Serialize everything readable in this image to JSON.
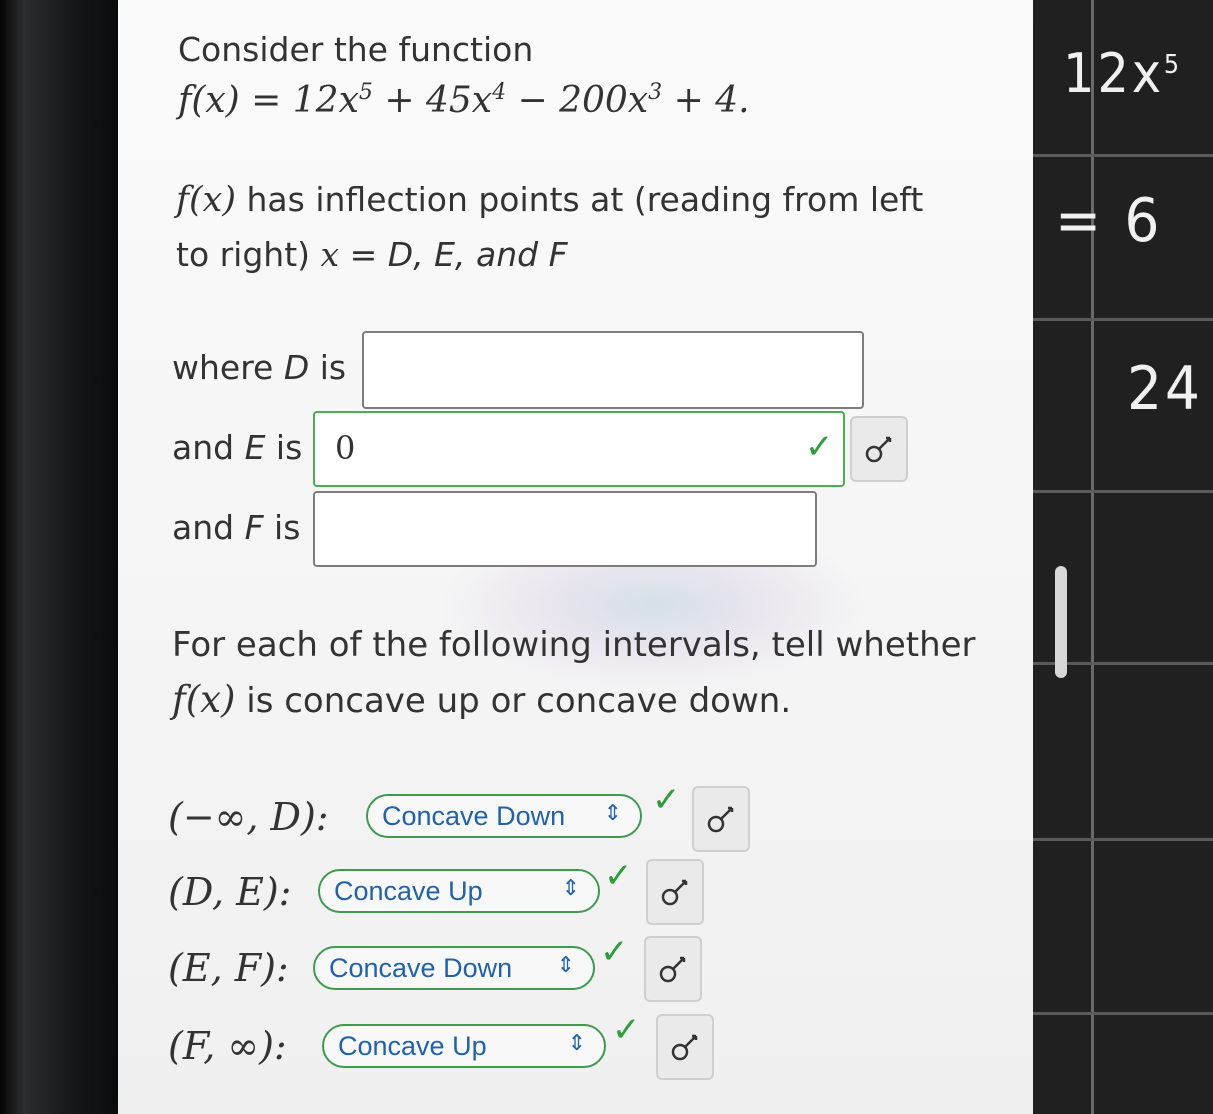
{
  "intro": "Consider the function",
  "function_label": "f(x) = 12x",
  "function_parts": {
    "exp5": "5",
    "mid1": " + 45x",
    "exp4": "4",
    "mid2": " − 200x",
    "exp3": "3",
    "end": " + 4."
  },
  "inflection_text_fx": "f(x)",
  "inflection_text": " has inflection points at (reading from left",
  "inflection_text2": "to right) ",
  "inflection_x_eq": "x",
  "inflection_vars": " = D, E, and F",
  "questions": [
    {
      "label_prefix": "where ",
      "var": "D",
      "label_suffix": " is",
      "value": "",
      "correct": false
    },
    {
      "label_prefix": "and ",
      "var": "E",
      "label_suffix": " is",
      "value": "0",
      "correct": true
    },
    {
      "label_prefix": "and ",
      "var": "F",
      "label_suffix": " is",
      "value": "",
      "correct": false
    }
  ],
  "concavity_prompt": "For each of the following intervals, tell whether",
  "concavity_prompt_fx": "f(x)",
  "concavity_prompt2": " is concave up or concave down.",
  "intervals": [
    {
      "interval": "(−∞, D):",
      "selected": "Concave Down"
    },
    {
      "interval": "(D, E):",
      "selected": "Concave Up"
    },
    {
      "interval": "(E, F):",
      "selected": "Concave Down"
    },
    {
      "interval": "(F, ∞):",
      "selected": "Concave Up"
    }
  ],
  "icons": {
    "check": "check-icon",
    "key": "key-icon",
    "chevron": "updown-chevron-icon"
  },
  "colors": {
    "correct_border": "#4caf50",
    "check": "#2e9d3a",
    "select_text": "#2262a9"
  },
  "handwriting": {
    "line1": "12x",
    "line1_sup": "5",
    "line2": "= 6",
    "line3": "24"
  }
}
